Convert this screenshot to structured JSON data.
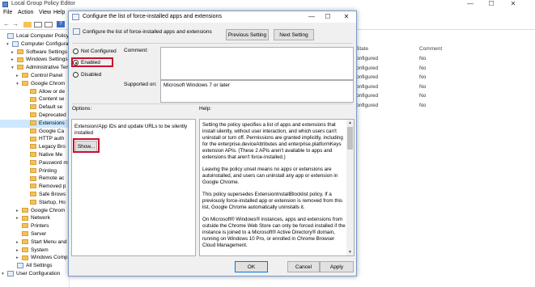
{
  "editor": {
    "title": "Local Group Policy Editor",
    "menu": [
      "File",
      "Action",
      "View",
      "Help"
    ],
    "window_controls": [
      "—",
      "☐",
      "✕"
    ],
    "tree": [
      {
        "label": "Local Computer Policy",
        "kind": "doc",
        "arrow": ""
      },
      {
        "label": "Computer Configurati",
        "kind": "doc",
        "arrow": "v"
      },
      {
        "label": "Software Settings",
        "kind": "folder",
        "arrow": ">"
      },
      {
        "label": "Windows Settings",
        "kind": "folder",
        "arrow": ">"
      },
      {
        "label": "Administrative Tem",
        "kind": "folder",
        "arrow": "v"
      },
      {
        "label": "Control Panel",
        "kind": "folder",
        "arrow": ">"
      },
      {
        "label": "Google Chrom",
        "kind": "folder",
        "arrow": "v"
      },
      {
        "label": "Allow or de",
        "kind": "folder",
        "arrow": ""
      },
      {
        "label": "Content se",
        "kind": "folder",
        "arrow": ""
      },
      {
        "label": "Default se",
        "kind": "folder",
        "arrow": ""
      },
      {
        "label": "Deprecated",
        "kind": "folder",
        "arrow": ""
      },
      {
        "label": "Extensions",
        "kind": "folder",
        "arrow": "",
        "selected": true
      },
      {
        "label": "Google Ca",
        "kind": "folder",
        "arrow": ""
      },
      {
        "label": "HTTP auth",
        "kind": "folder",
        "arrow": ""
      },
      {
        "label": "Legacy Bro",
        "kind": "folder",
        "arrow": ""
      },
      {
        "label": "Native Me",
        "kind": "folder",
        "arrow": ""
      },
      {
        "label": "Password m",
        "kind": "folder",
        "arrow": ""
      },
      {
        "label": "Printing",
        "kind": "folder",
        "arrow": ""
      },
      {
        "label": "Remote ac",
        "kind": "folder",
        "arrow": ""
      },
      {
        "label": "Removed p",
        "kind": "folder",
        "arrow": ""
      },
      {
        "label": "Safe Brows",
        "kind": "folder",
        "arrow": ""
      },
      {
        "label": "Startup, Ho",
        "kind": "folder",
        "arrow": ""
      },
      {
        "label": "Google Chrom",
        "kind": "folder",
        "arrow": ">"
      },
      {
        "label": "Network",
        "kind": "folder",
        "arrow": ">"
      },
      {
        "label": "Printers",
        "kind": "folder",
        "arrow": ""
      },
      {
        "label": "Server",
        "kind": "folder",
        "arrow": ""
      },
      {
        "label": "Start Menu and",
        "kind": "folder",
        "arrow": ">"
      },
      {
        "label": "System",
        "kind": "folder",
        "arrow": ">"
      },
      {
        "label": "Windows Comp",
        "kind": "folder",
        "arrow": ">"
      },
      {
        "label": "All Settings",
        "kind": "doc",
        "arrow": ""
      },
      {
        "label": "User Configuration",
        "kind": "doc",
        "arrow": "v"
      }
    ],
    "list": {
      "headers": [
        "State",
        "Comment"
      ],
      "rows": [
        [
          "onfigured",
          "No"
        ],
        [
          "onfigured",
          "No"
        ],
        [
          "onfigured",
          "No"
        ],
        [
          "onfigured",
          "No"
        ],
        [
          "onfigured",
          "No"
        ],
        [
          "onfigured",
          "No"
        ]
      ]
    }
  },
  "dialog": {
    "title": "Configure the list of force-installed apps and extensions",
    "header": "Configure the list of force-installed apps and extensions",
    "prev_label": "Previous Setting",
    "next_label": "Next Setting",
    "radios": [
      {
        "label": "Not Configured",
        "checked": false
      },
      {
        "label": "Enabled",
        "checked": true
      },
      {
        "label": "Disabled",
        "checked": false
      }
    ],
    "comment_label": "Comment:",
    "comment_value": "",
    "supported_label": "Supported on:",
    "supported_value": "Microsoft Windows 7 or later",
    "options_label": "Options:",
    "help_label": "Help:",
    "options_desc": "Extension/App IDs and update URLs to be silently installed",
    "show_label": "Show...",
    "help_paragraphs": [
      "Setting the policy specifies a list of apps and extensions that install silently, without user interaction, and which users can't uninstall or turn off. Permissions are granted implicitly, including for the enterprise.deviceAttributes and enterprise.platformKeys extension APIs. (These 2 APIs aren't available to apps and extensions that aren't force-installed.)",
      "Leaving the policy unset means no apps or extensions are autoinstalled, and users can uninstall any app or extension in Google Chrome.",
      "This policy supersedes ExtensionInstallBlocklist policy. If a previously force-installed app or extension is removed from this list, Google Chrome automatically uninstalls it.",
      "On Microsoft® Windows® instances, apps and extensions from outside the Chrome Web Store can only be forced installed if the instance is joined to a Microsoft® Active Directory® domain, running on Windows 10 Pro, or enrolled in Chrome Browser Cloud Management."
    ],
    "ok_label": "OK",
    "cancel_label": "Cancel",
    "apply_label": "Apply",
    "highlight_color": "#c8102e",
    "icons": [
      "policy-icon",
      "close-icon",
      "maximize-icon",
      "minimize-icon",
      "scroll-up-icon",
      "scroll-down-icon"
    ]
  }
}
